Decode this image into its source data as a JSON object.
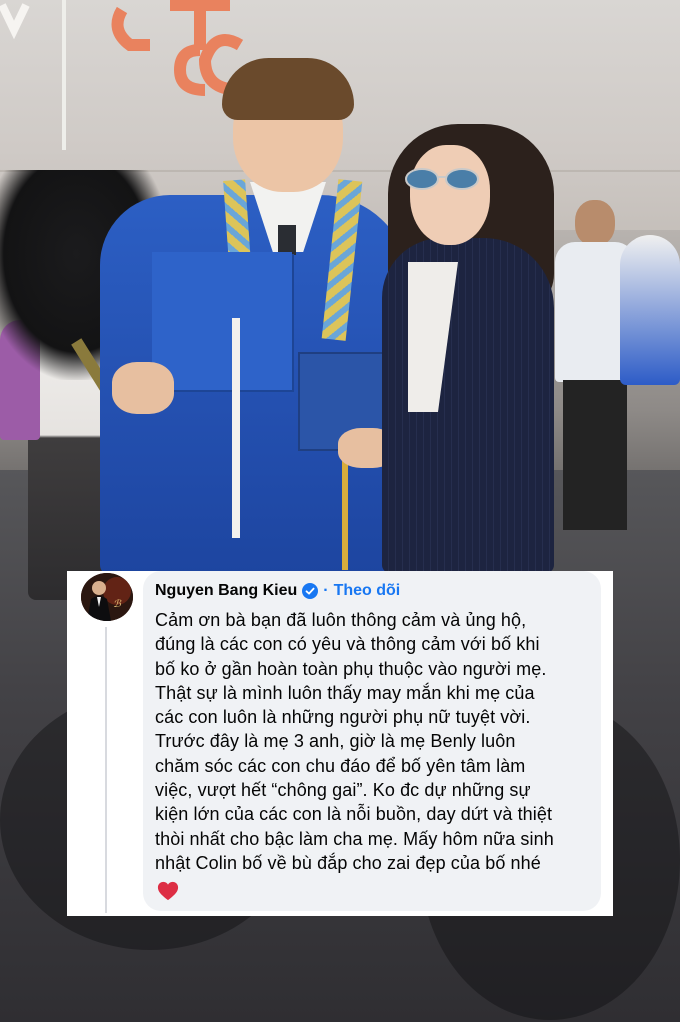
{
  "comment": {
    "author": "Nguyen Bang Kieu",
    "separator": "·",
    "follow_label": "Theo dõi",
    "lines": [
      "Cảm ơn bà bạn đã luôn thông cảm và ủng hộ,",
      "đúng là các con có yêu và thông cảm với bố khi",
      "bố ko ở gần hoàn toàn phụ thuộc vào người mẹ.",
      "Thật sự là mình luôn thấy may mắn khi mẹ của",
      "các con luôn là những người phụ nữ tuyệt vời.",
      "Trước đây là mẹ 3 anh, giờ là mẹ Benly luôn",
      "chăm sóc các con chu đáo để bố yên tâm làm",
      "việc, vượt hết “chông gai”. Ko đc dự những sự",
      "kiện lớn của các con là nỗi buồn, day dứt và thiệt",
      "thòi nhất cho bậc làm cha mẹ. Mấy hôm nữa sinh",
      "nhật Colin bố về bù đắp cho zai đẹp của bố nhé"
    ],
    "emoji": "heart-emoji",
    "colors": {
      "link": "#1877f2",
      "bubble": "#f0f2f5",
      "text": "#050505",
      "heart": "#dd2e44"
    }
  },
  "photo": {
    "icon": "graduation-photo",
    "colors": {
      "gown": "#2450b0",
      "blazer": "#1d2440",
      "ground": "#434246"
    }
  }
}
